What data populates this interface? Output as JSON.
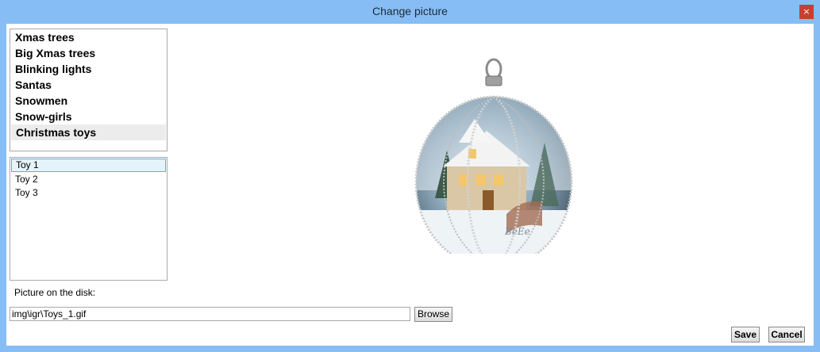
{
  "window": {
    "title": "Change picture",
    "close_glyph": "×"
  },
  "categories": [
    {
      "label": "Xmas trees"
    },
    {
      "label": "Big Xmas trees"
    },
    {
      "label": "Blinking lights"
    },
    {
      "label": "Santas"
    },
    {
      "label": "Snowmen"
    },
    {
      "label": "Snow-girls"
    },
    {
      "label": "Christmas toys",
      "selected": true
    }
  ],
  "items": [
    {
      "label": "Toy 1",
      "selected": true
    },
    {
      "label": "Toy 2"
    },
    {
      "label": "Toy 3"
    }
  ],
  "disk": {
    "label": "Picture on the disk:",
    "path_value": "img\\igr\\Toys_1.gif",
    "browse_label": "Browse"
  },
  "actions": {
    "save_label": "Save",
    "cancel_label": "Cancel"
  },
  "preview": {
    "icon": "christmas-ornament-picture",
    "signature": "BeEe"
  }
}
